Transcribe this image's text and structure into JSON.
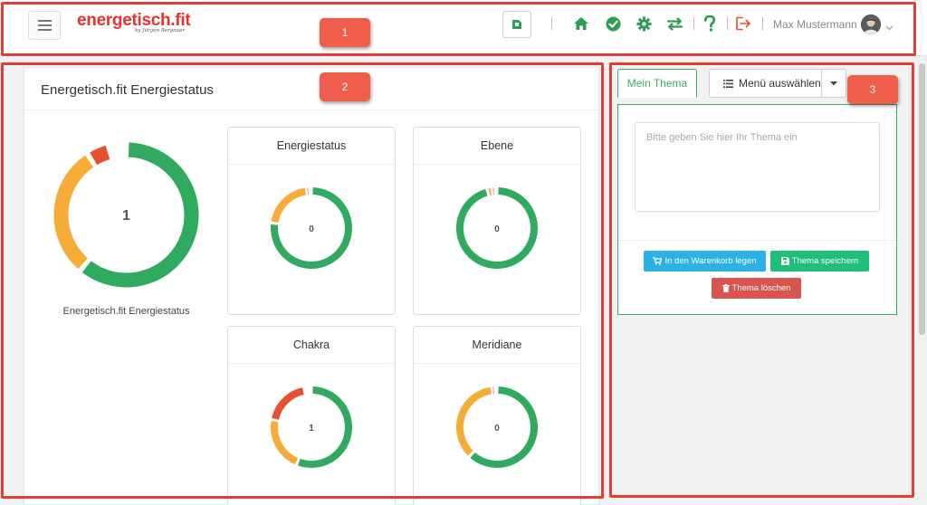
{
  "header": {
    "logo_text": "energetisch.fit",
    "logo_subtitle": "by Jürgen Bergauer",
    "user_name": "Max Mustermann"
  },
  "main_panel": {
    "title": "Energetisch.fit Energiestatus",
    "big_donut": {
      "value": "1",
      "label": "Energetisch.fit Energiestatus",
      "segments": {
        "green": 0.61,
        "orange": 0.3,
        "red": 0.05
      }
    },
    "cards": [
      {
        "title": "Energiestatus",
        "value": "0",
        "segments": {
          "green": 0.77,
          "orange": 0.21,
          "red": 0.01
        }
      },
      {
        "title": "Ebene",
        "value": "0",
        "segments": {
          "green": 0.96,
          "orange": 0.02,
          "red": 0.01
        }
      },
      {
        "title": "Chakra",
        "value": "1",
        "segments": {
          "green": 0.56,
          "orange": 0.22,
          "red": 0.19
        }
      },
      {
        "title": "Meridiane",
        "value": "0",
        "segments": {
          "green": 0.62,
          "orange": 0.36,
          "red": 0.01
        }
      }
    ]
  },
  "right_panel": {
    "tab_label": "Mein Thema",
    "menu_label": "Menü auswählen",
    "textarea_placeholder": "Bitte geben Sie hier Ihr Thema ein",
    "btn_cart": "In den Warenkorb legen",
    "btn_save": "Thema speichern",
    "btn_delete": "Thema löschen"
  },
  "annotations": [
    "1",
    "2",
    "3"
  ],
  "colors": {
    "green": "#2faa5f",
    "orange": "#f5ad37",
    "red": "#e5522b",
    "accent": "#2f9d55",
    "annotation": "#e53d35"
  }
}
